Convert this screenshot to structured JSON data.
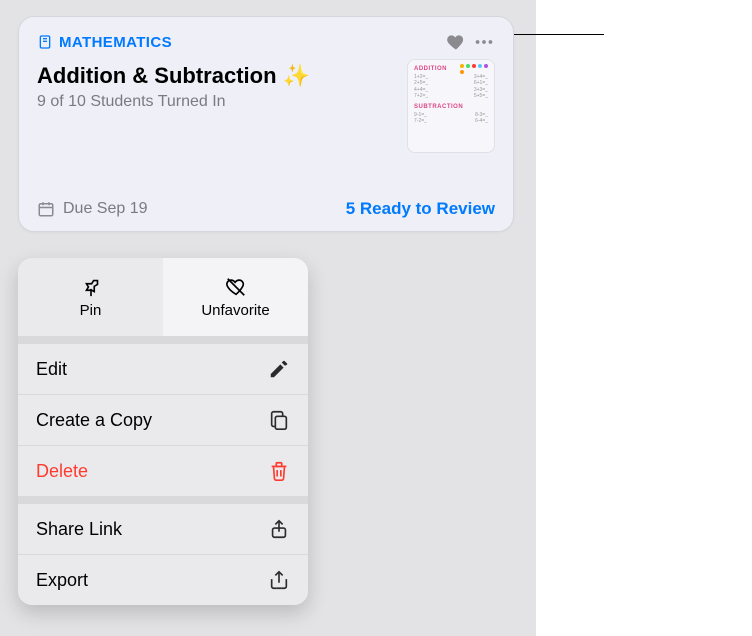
{
  "card": {
    "subject": "MATHEMATICS",
    "title": "Addition & Subtraction ✨",
    "subtitle": "9 of 10 Students Turned In",
    "due_label": "Due Sep 19",
    "review_label": "5 Ready to Review",
    "thumb": {
      "section1": "ADDITION",
      "section2": "SUBTRACTION"
    }
  },
  "menu": {
    "pin_label": "Pin",
    "unfavorite_label": "Unfavorite",
    "edit_label": "Edit",
    "copy_label": "Create a Copy",
    "delete_label": "Delete",
    "share_label": "Share Link",
    "export_label": "Export"
  },
  "colors": {
    "accent": "#007aff",
    "danger": "#ff3b30"
  }
}
